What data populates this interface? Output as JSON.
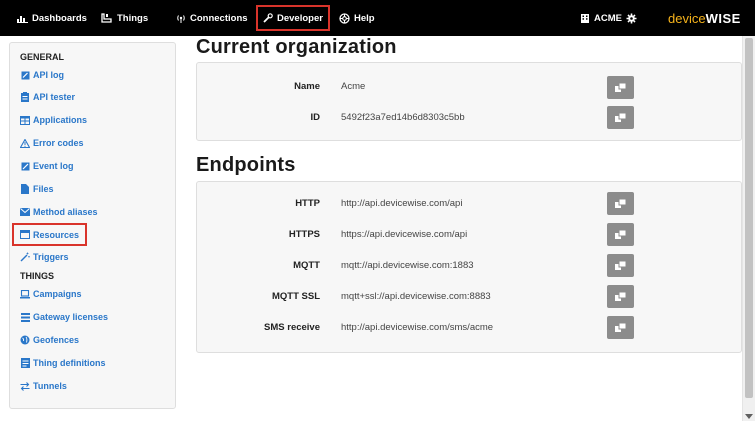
{
  "nav": {
    "items": [
      {
        "label": "Dashboards",
        "icon": "bar-chart-icon"
      },
      {
        "label": "Things",
        "icon": "things-icon"
      },
      {
        "label": "Connections",
        "icon": "signal-icon"
      },
      {
        "label": "Developer",
        "icon": "wrench-icon",
        "active": true
      },
      {
        "label": "Help",
        "icon": "help-lifebuoy-icon"
      }
    ],
    "org_label": "ACME",
    "org_icon": "building-icon",
    "settings_icon": "gear-icon",
    "brand_part1": "device",
    "brand_part2": "WISE"
  },
  "sidebar": {
    "general_heading": "GENERAL",
    "general_items": [
      {
        "label": "API log",
        "icon": "log-icon"
      },
      {
        "label": "API tester",
        "icon": "clipboard-icon"
      },
      {
        "label": "Applications",
        "icon": "table-icon"
      },
      {
        "label": "Error codes",
        "icon": "warning-icon"
      },
      {
        "label": "Event log",
        "icon": "edit-log-icon"
      },
      {
        "label": "Files",
        "icon": "file-icon"
      },
      {
        "label": "Method aliases",
        "icon": "envelope-icon"
      },
      {
        "label": "Resources",
        "icon": "window-icon",
        "highlighted": true
      },
      {
        "label": "Triggers",
        "icon": "magic-wand-icon"
      }
    ],
    "things_heading": "THINGS",
    "things_items": [
      {
        "label": "Campaigns",
        "icon": "laptop-icon"
      },
      {
        "label": "Gateway licenses",
        "icon": "list-icon"
      },
      {
        "label": "Geofences",
        "icon": "globe-icon"
      },
      {
        "label": "Thing definitions",
        "icon": "document-icon"
      },
      {
        "label": "Tunnels",
        "icon": "swap-icon"
      }
    ]
  },
  "org": {
    "title": "Current organization",
    "rows": [
      {
        "label": "Name",
        "value": "Acme"
      },
      {
        "label": "ID",
        "value": "5492f23a7ed14b6d8303c5bb"
      }
    ]
  },
  "endpoints": {
    "title": "Endpoints",
    "rows": [
      {
        "label": "HTTP",
        "value": "http://api.devicewise.com/api"
      },
      {
        "label": "HTTPS",
        "value": "https://api.devicewise.com/api"
      },
      {
        "label": "MQTT",
        "value": "mqtt://api.devicewise.com:1883"
      },
      {
        "label": "MQTT SSL",
        "value": "mqtt+ssl://api.devicewise.com:8883"
      },
      {
        "label": "SMS receive",
        "value": "http://api.devicewise.com/sms/acme"
      }
    ]
  },
  "copy_icon": "copy-icon",
  "colors": {
    "topbar": "#000000",
    "link": "#2a77c9",
    "highlight_border": "#d9342b",
    "brand_accent": "#f6b31b",
    "copy_button": "#8c8c8c"
  }
}
